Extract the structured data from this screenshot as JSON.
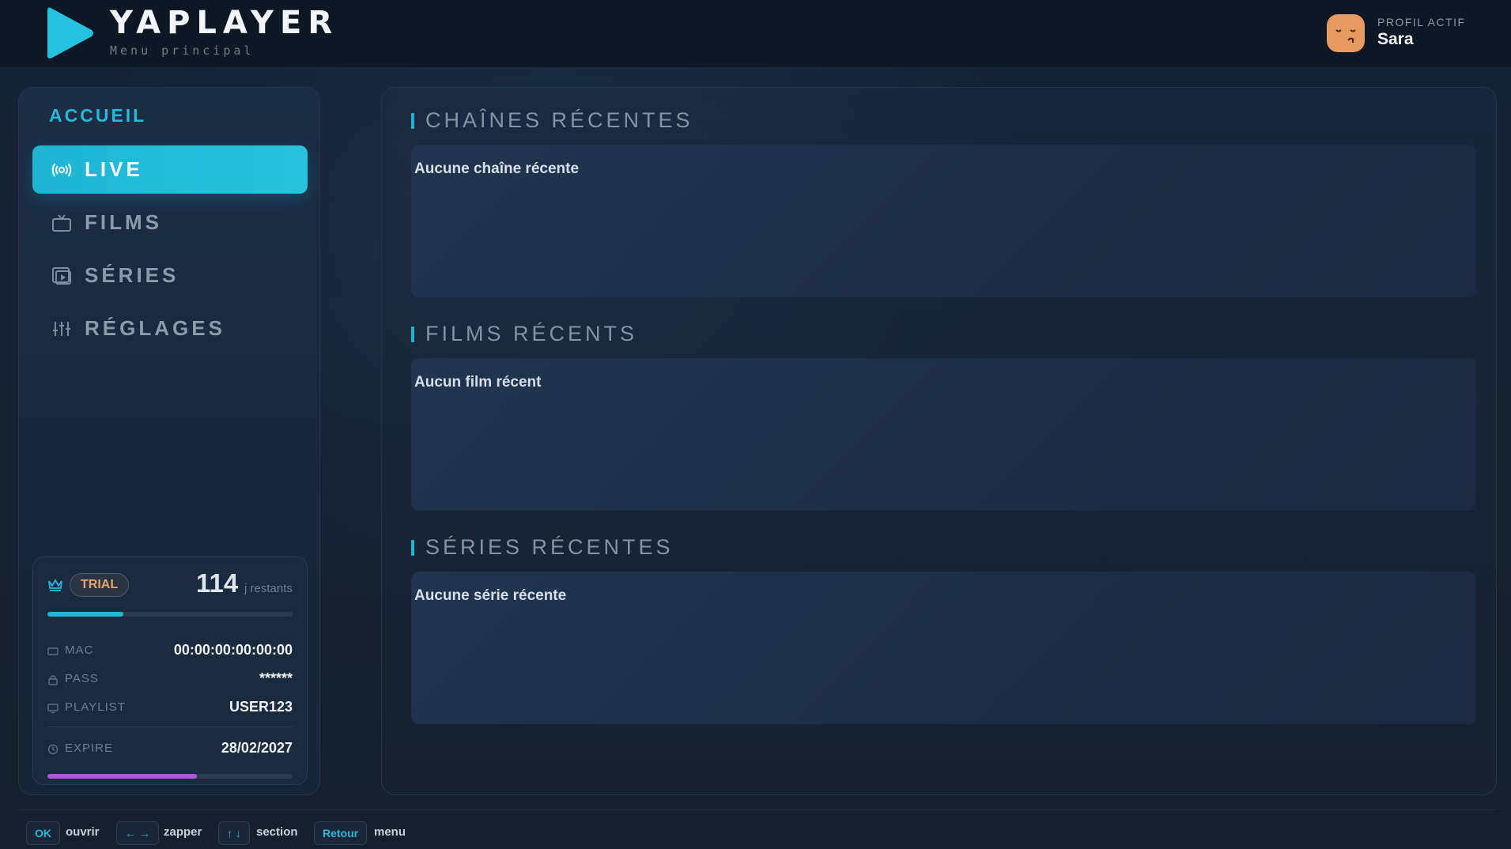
{
  "header": {
    "app_name": "YAPLAYER",
    "subtitle": "Menu principal",
    "profile_label": "PROFIL ACTIF",
    "profile_name": "Sara"
  },
  "sidebar": {
    "title": "ACCUEIL",
    "items": [
      {
        "label": "LIVE",
        "icon": "broadcast-icon",
        "active": true
      },
      {
        "label": "FILMS",
        "icon": "tv-icon",
        "active": false
      },
      {
        "label": "SÉRIES",
        "icon": "series-icon",
        "active": false
      },
      {
        "label": "RÉGLAGES",
        "icon": "sliders-icon",
        "active": false
      }
    ]
  },
  "subscription": {
    "badge": "TRIAL",
    "days_remaining": "114",
    "days_unit": "j restants",
    "trial_progress": 0.31,
    "mac_label": "MAC",
    "mac_value": "00:00:00:00:00:00",
    "pass_label": "PASS",
    "pass_value": "******",
    "playlist_label": "PLAYLIST",
    "playlist_value": "USER123",
    "expire_label": "EXPIRE",
    "expire_value": "28/02/2027",
    "expire_progress": 0.61
  },
  "main": {
    "sections": [
      {
        "title": "CHAÎNES RÉCENTES",
        "empty_text": "Aucune chaîne récente"
      },
      {
        "title": "FILMS RÉCENTS",
        "empty_text": "Aucun film récent"
      },
      {
        "title": "SÉRIES RÉCENTES",
        "empty_text": "Aucune série récente"
      }
    ]
  },
  "footer": {
    "hints": [
      {
        "key": "OK",
        "desc": "ouvrir"
      },
      {
        "key": "← →",
        "desc": "zapper"
      },
      {
        "key": "↑ ↓",
        "desc": "section"
      },
      {
        "key": "Retour",
        "desc": "menu"
      }
    ]
  },
  "colors": {
    "accent": "#23b6d8",
    "expire_bar": "#b154e0",
    "badge_text": "#e7a56c",
    "avatar": "#e79a62"
  }
}
